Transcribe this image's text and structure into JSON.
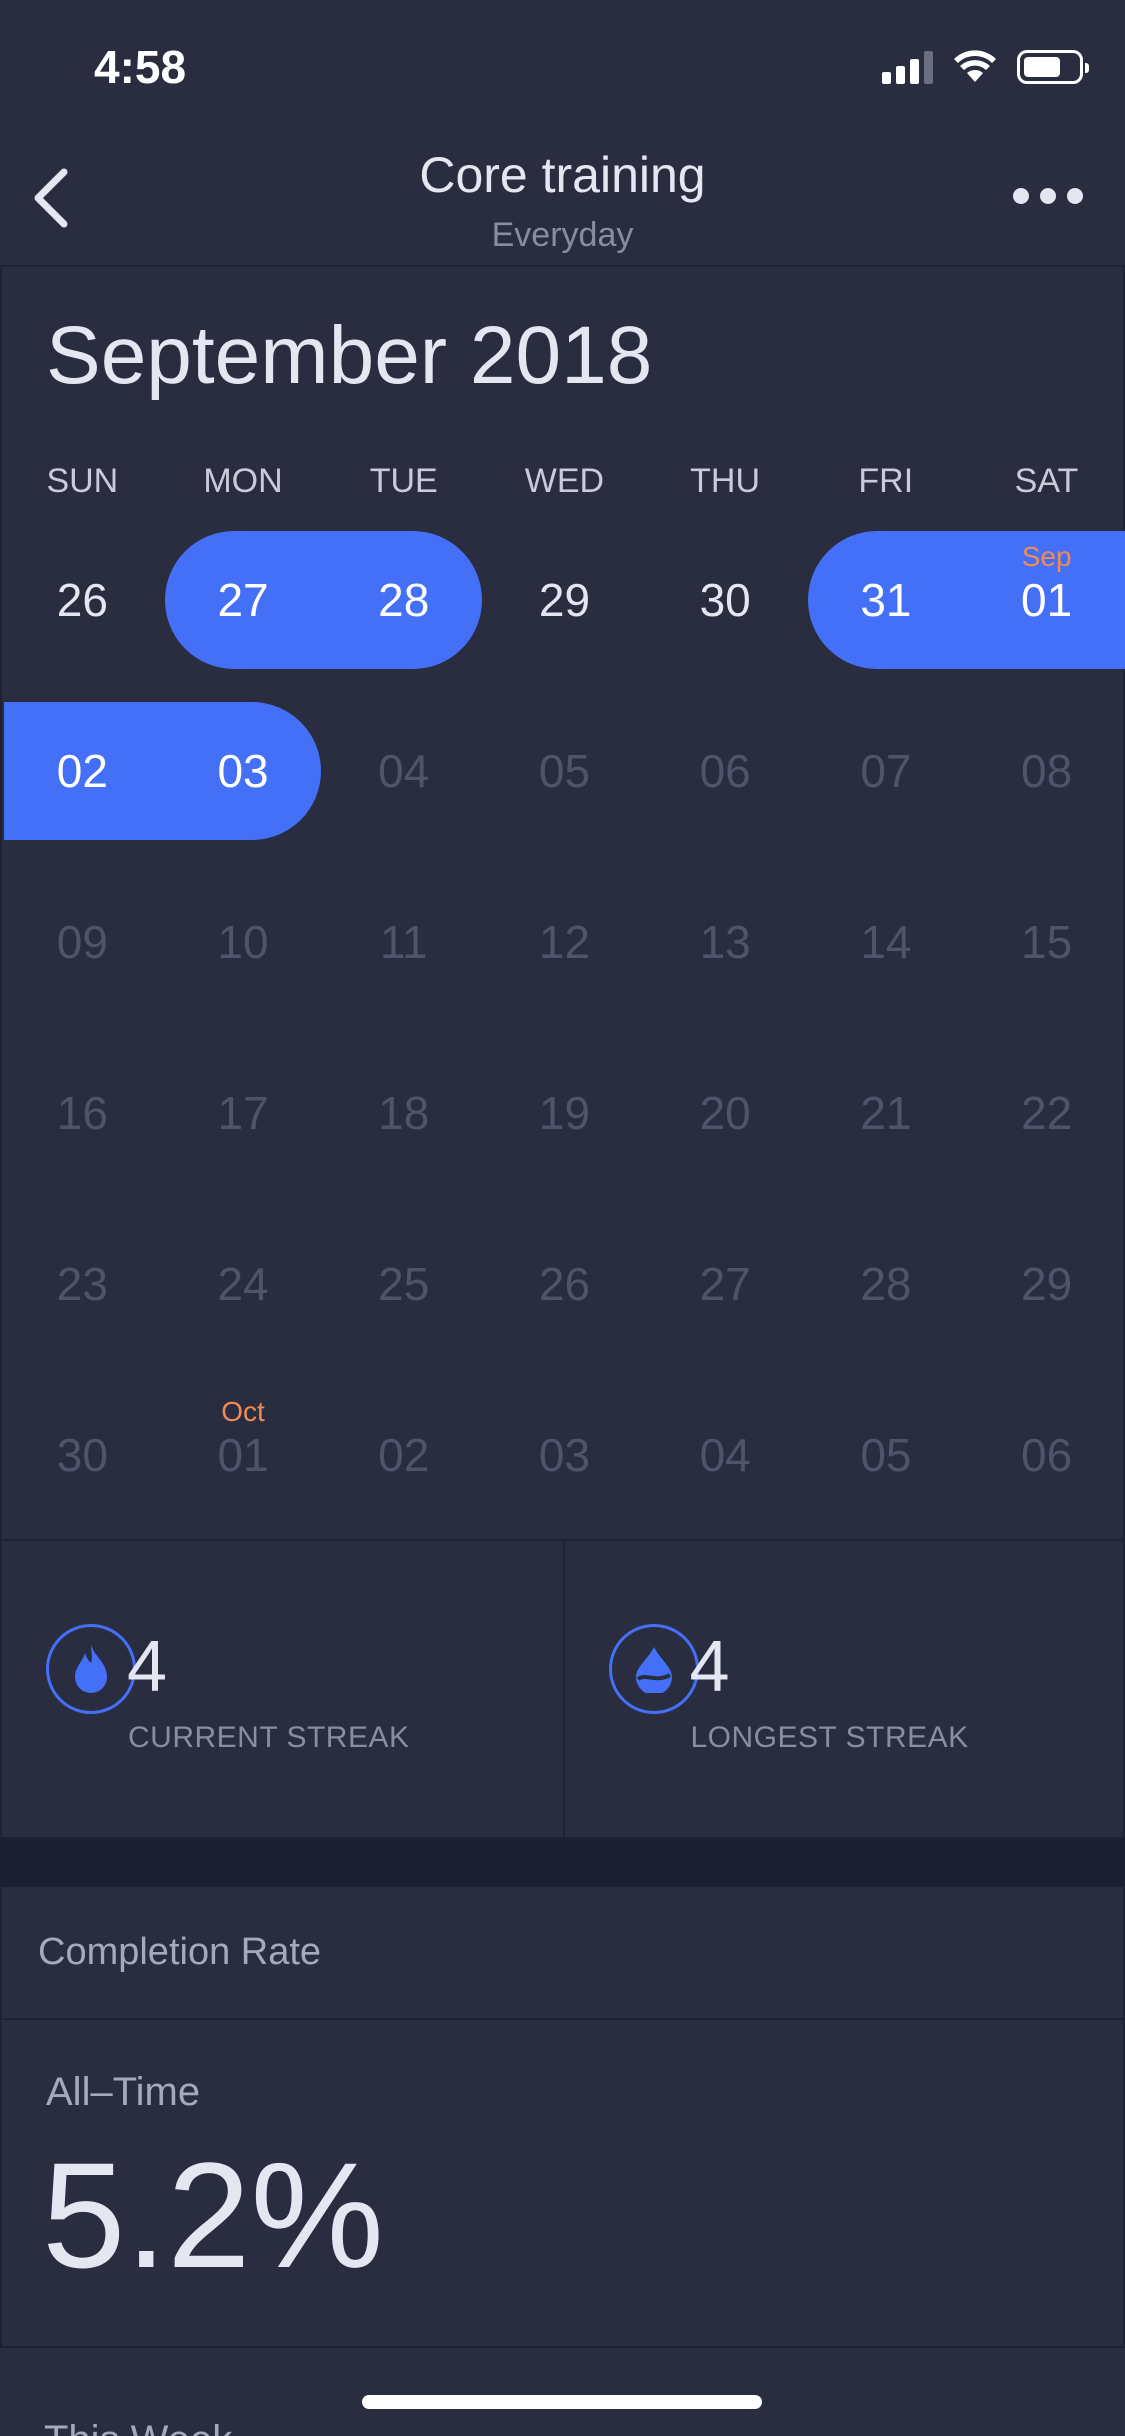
{
  "status_bar": {
    "time": "4:58"
  },
  "nav": {
    "title": "Core training",
    "subtitle": "Everyday"
  },
  "calendar": {
    "month": "September 2018",
    "weekdays": [
      "SUN",
      "MON",
      "TUE",
      "WED",
      "THU",
      "FRI",
      "SAT"
    ],
    "weeks": [
      {
        "days": [
          {
            "label": "26",
            "state": "current"
          },
          {
            "label": "27",
            "state": "active"
          },
          {
            "label": "28",
            "state": "active"
          },
          {
            "label": "29",
            "state": "current"
          },
          {
            "label": "30",
            "state": "current"
          },
          {
            "label": "31",
            "state": "active"
          },
          {
            "label": "01",
            "state": "active",
            "mark": "Sep"
          }
        ]
      },
      {
        "days": [
          {
            "label": "02",
            "state": "active"
          },
          {
            "label": "03",
            "state": "active"
          },
          {
            "label": "04",
            "state": "dim"
          },
          {
            "label": "05",
            "state": "dim"
          },
          {
            "label": "06",
            "state": "dim"
          },
          {
            "label": "07",
            "state": "dim"
          },
          {
            "label": "08",
            "state": "dim"
          }
        ]
      },
      {
        "days": [
          {
            "label": "09",
            "state": "dim"
          },
          {
            "label": "10",
            "state": "dim"
          },
          {
            "label": "11",
            "state": "dim"
          },
          {
            "label": "12",
            "state": "dim"
          },
          {
            "label": "13",
            "state": "dim"
          },
          {
            "label": "14",
            "state": "dim"
          },
          {
            "label": "15",
            "state": "dim"
          }
        ]
      },
      {
        "days": [
          {
            "label": "16",
            "state": "dim"
          },
          {
            "label": "17",
            "state": "dim"
          },
          {
            "label": "18",
            "state": "dim"
          },
          {
            "label": "19",
            "state": "dim"
          },
          {
            "label": "20",
            "state": "dim"
          },
          {
            "label": "21",
            "state": "dim"
          },
          {
            "label": "22",
            "state": "dim"
          }
        ]
      },
      {
        "days": [
          {
            "label": "23",
            "state": "dim"
          },
          {
            "label": "24",
            "state": "dim"
          },
          {
            "label": "25",
            "state": "dim"
          },
          {
            "label": "26",
            "state": "dim"
          },
          {
            "label": "27",
            "state": "dim"
          },
          {
            "label": "28",
            "state": "dim"
          },
          {
            "label": "29",
            "state": "dim"
          }
        ]
      },
      {
        "days": [
          {
            "label": "30",
            "state": "dim"
          },
          {
            "label": "01",
            "state": "dim",
            "mark": "Oct"
          },
          {
            "label": "02",
            "state": "dim"
          },
          {
            "label": "03",
            "state": "dim"
          },
          {
            "label": "04",
            "state": "dim"
          },
          {
            "label": "05",
            "state": "dim"
          },
          {
            "label": "06",
            "state": "dim"
          }
        ]
      }
    ]
  },
  "streaks": {
    "current": {
      "value": "4",
      "label": "CURRENT STREAK",
      "icon": "flame-icon"
    },
    "longest": {
      "value": "4",
      "label": "LONGEST STREAK",
      "icon": "drop-icon"
    }
  },
  "completion": {
    "header": "Completion Rate",
    "all_time_label": "All–Time",
    "all_time_value": "5.2%",
    "this_week_label": "This Week"
  },
  "colors": {
    "accent": "#4470f7",
    "month_marker": "#f08a56",
    "background": "#2a2d40"
  }
}
